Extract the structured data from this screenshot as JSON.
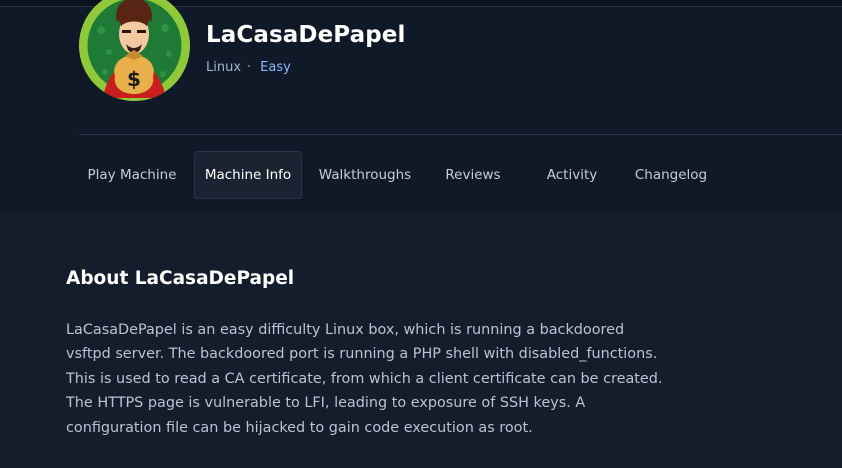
{
  "machine": {
    "name": "LaCasaDePapel",
    "os": "Linux",
    "separator": "·",
    "difficulty": "Easy",
    "avatar_icon": "money-bag-character-avatar"
  },
  "tabs": [
    {
      "label": "Play Machine",
      "active": false
    },
    {
      "label": "Machine Info",
      "active": true
    },
    {
      "label": "Walkthroughs",
      "active": false
    },
    {
      "label": "Reviews",
      "active": false
    },
    {
      "label": "Activity",
      "active": false
    },
    {
      "label": "Changelog",
      "active": false
    }
  ],
  "about": {
    "title": "About LaCasaDePapel",
    "lines": [
      "LaCasaDePapel is an easy difficulty Linux box, which is running a backdoored",
      "vsftpd server. The backdoored port is running a PHP shell with disabled_functions.",
      "This is used to read a CA certificate, from which a client certificate can be created.",
      "The HTTPS page is vulnerable to LFI, leading to exposure of SSH keys. A",
      "configuration file can be hijacked to gain code execution as root."
    ]
  },
  "colors": {
    "background": "#141d2b",
    "header": "#101927",
    "difficulty_easy": "#8db8ff",
    "avatar_ring": "#8fc93a"
  }
}
